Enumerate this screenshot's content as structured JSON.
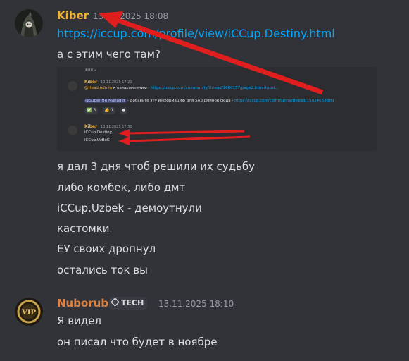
{
  "messages": [
    {
      "author": "Kiber",
      "author_color": "#f0b232",
      "timestamp": "13.11.2025 18:08",
      "lines": [
        "https://iccup.com/profile/view/iCCup.Destiny.html",
        "а с этим чего там?"
      ],
      "embedded_screenshot": {
        "top_label": "▪▪▪ 2",
        "messages": [
          {
            "author": "Kiber",
            "timestamp": "10.11.2025 17:21",
            "mention": "@Head Admin",
            "text": " к ознакомлению - ",
            "link": "https://iccup.com/community/thread/1660157/page2.html#post...",
            "extra_mention": "@Super HR Manager",
            "extra_text": " - добавьте эту информацию для 5А админов сюда - ",
            "extra_link": "https://iccup.com/community/thread/1592465.html",
            "reactions": [
              "✅ 3",
              "👍 1",
              "●"
            ]
          },
          {
            "author": "Kiber",
            "timestamp": "10.11.2025 17:31",
            "lines": [
              "iCCup.Destiny",
              "iCCup.UzBeK"
            ]
          }
        ]
      },
      "more_lines": [
        "я дал 3 дня чтоб решили их судьбу",
        "либо комбек, либо дмт",
        "iCCup.Uzbek - демоутнули",
        "кастомки",
        "ЕУ своих дропнул",
        "остались ток вы"
      ]
    },
    {
      "author": "Nuborub",
      "author_color": "#e0823d",
      "tag": "TECH",
      "timestamp": "13.11.2025 18:10",
      "lines": [
        "Я видел",
        "он писал что будет в ноябре"
      ]
    }
  ],
  "colors": {
    "background": "#323339",
    "link": "#00a8fc",
    "annotation_arrow": "#e01e1e"
  }
}
